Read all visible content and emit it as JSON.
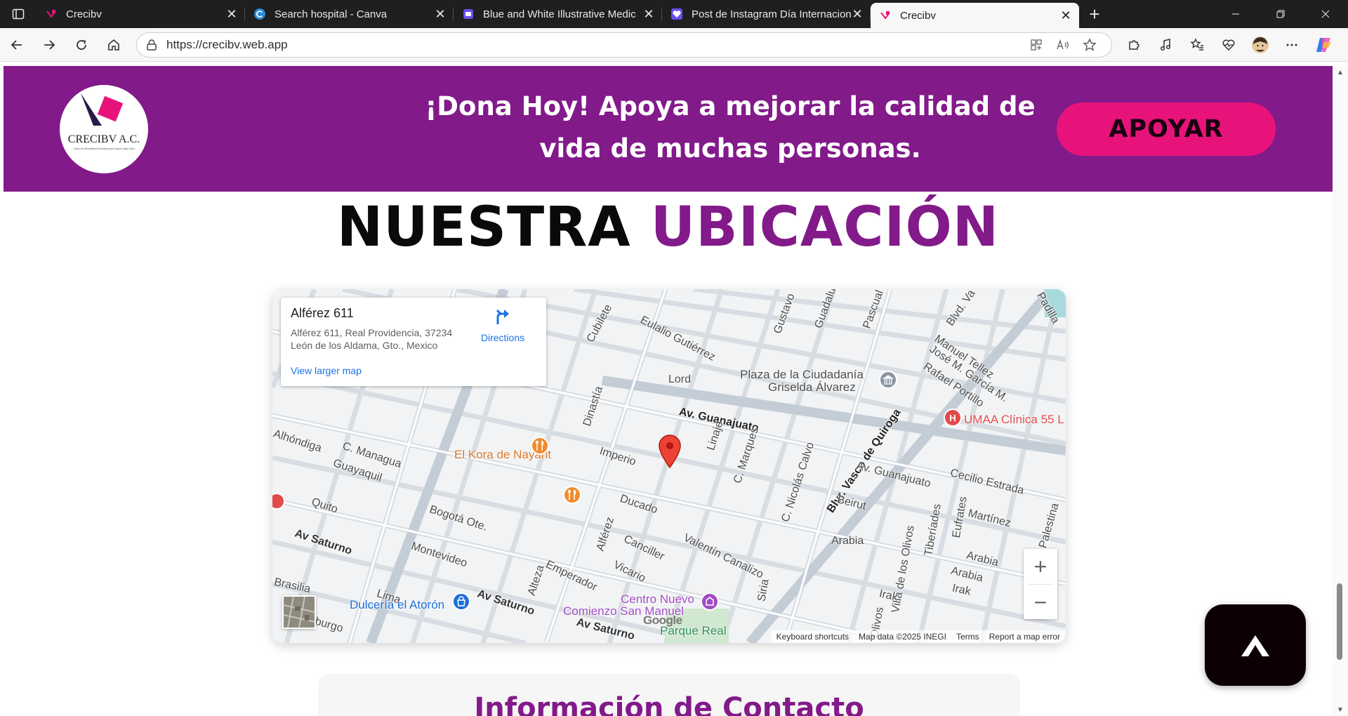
{
  "browser": {
    "tabs": [
      {
        "title": "Crecibv",
        "favicon": "crecibv-icon",
        "active": false
      },
      {
        "title": "Search hospital - Canva",
        "favicon": "canva-icon",
        "active": false
      },
      {
        "title": "Blue and White Illustrative Medic",
        "favicon": "document-icon",
        "active": false
      },
      {
        "title": "Post de Instagram Día Internacion",
        "favicon": "heart-icon",
        "active": false
      },
      {
        "title": "Crecibv",
        "favicon": "crecibv-icon",
        "active": true
      }
    ],
    "new_tab": "+",
    "url": "https://crecibv.web.app"
  },
  "banner": {
    "logo_text": "CRECIBV A.C.",
    "logo_subtext": "Centro de Rehabilitación Educativa para Ciegos y Baja Visión",
    "headline_line1": "¡Dona Hoy! Apoya a mejorar la calidad de",
    "headline_line2": "vida de muchas personas.",
    "cta_label": "APOYAR",
    "background": "#821a8a",
    "cta_color": "#e8137a"
  },
  "location": {
    "title_part1": "NUESTRA",
    "title_part2": "UBICACIÓN"
  },
  "map": {
    "place_name": "Alférez 611",
    "address_line1": "Alférez 611, Real Providencia, 37234",
    "address_line2": "León de los Aldama, Gto., Mexico",
    "directions_label": "Directions",
    "view_larger_label": "View larger map",
    "zoom_in": "+",
    "zoom_out": "−",
    "google_logo": "Google",
    "attribution": {
      "shortcuts": "Keyboard shortcuts",
      "map_data": "Map data ©2025 INEGI",
      "terms": "Terms",
      "report": "Report a map error"
    },
    "labels": {
      "cubilete": "Cubilete",
      "eulalio": "Eulalio Gutiérrez",
      "gustavo": "Gustavo",
      "guadalupe": "Guadalu",
      "pascual": "Pascual",
      "blvd_va": "Blvd. Va",
      "padilla": "Padilla",
      "lord": "Lord",
      "plaza1": "Plaza de la Ciudadanía",
      "plaza2": "Griselda Álvarez",
      "manuel": "Manuel Tellez",
      "jose": "José M. García M.",
      "rafael": "Rafael Portillo",
      "umaa": "UMAA Clínica 55 L",
      "dinastia": "Dinastía",
      "av_guanajuato1": "Av. Guanajuato",
      "alhondiga": "Alhóndiga",
      "managua": "C. Managua",
      "guayaquil": "Guayaquil",
      "kora": "El Kora de Nayarit",
      "imperio": "Imperio",
      "linaje": "Linaje",
      "marques": "C. Marques",
      "nicolas": "C. Nicolás Calvo",
      "vasco": "Blvr. Vasco de Quiroga",
      "av_guanajuato2": "Av. Guanajuato",
      "cecilio": "Cecilio Estrada",
      "quito": "Quito",
      "bogota": "Bogotá Ote.",
      "ducado": "Ducado",
      "alferez": "Alférez",
      "beirut": "Beirut",
      "martinez": "Martínez",
      "palestina": "Palestina",
      "saturno1": "Av Saturno",
      "montevideo": "Montevideo",
      "canciller": "Canciller",
      "valentin": "Valentín Canalizo",
      "arabia1": "Arabia",
      "olivos1": "Villa de los Olivos",
      "tiberiades": "Tiberíades",
      "eufrates": "Eufrates",
      "arabia2": "Arabia",
      "arabia3": "Arabia",
      "brasilia": "Brasilia",
      "emperador": "Emperador",
      "vicario": "Vicario",
      "alteza": "Alteza",
      "lima": "Lima",
      "centro1": "Centro Nuevo",
      "centro2": "Comienzo San Manuel",
      "siria": "Siria",
      "irak1": "Irak",
      "irak2": "Irak",
      "dulceria": "Dulcería el Atorón",
      "saturno2": "Av Saturno",
      "saturno3": "Av Saturno",
      "parque": "Parque Real",
      "burgo": "burgo",
      "olivos2": "Olivos"
    }
  },
  "contact": {
    "title": "Información de Contacto"
  }
}
